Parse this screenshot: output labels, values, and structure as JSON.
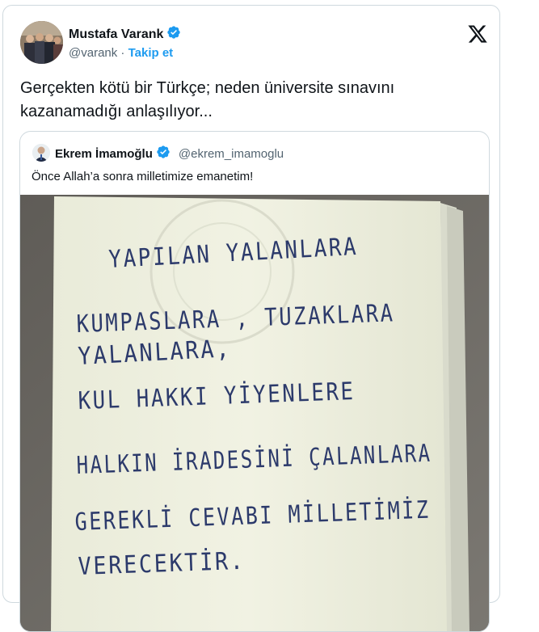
{
  "tweet": {
    "author_name": "Mustafa Varank",
    "author_handle": "@varank",
    "separator": "·",
    "follow_label": "Takip et",
    "text": "Gerçekten kötü bir Türkçe; neden üniversite sınavını kazanamadığı anlaşılıyor...",
    "verified": true
  },
  "quoted_tweet": {
    "author_name": "Ekrem İmamoğlu",
    "author_handle": "@ekrem_imamoglu",
    "text": "Önce Allah’a sonra milletimize emanetim!",
    "verified": true,
    "image_handwriting": [
      "YAPILAN YALANLARA",
      "KUMPASLARA , TUZAKLARA",
      "YALANLARA,",
      "KUL HAKKI YİYENLERE",
      "HALKIN İRADESİNİ ÇALANLARA",
      "GEREKLİ CEVABI MİLLETİMİZ",
      "VERECEKTİR."
    ]
  },
  "icons": {
    "verified": "verified-badge-icon",
    "platform": "x-logo-icon"
  },
  "colors": {
    "accent": "#1d9bf0",
    "secondary_text": "#536471",
    "border": "#cfd9de"
  }
}
